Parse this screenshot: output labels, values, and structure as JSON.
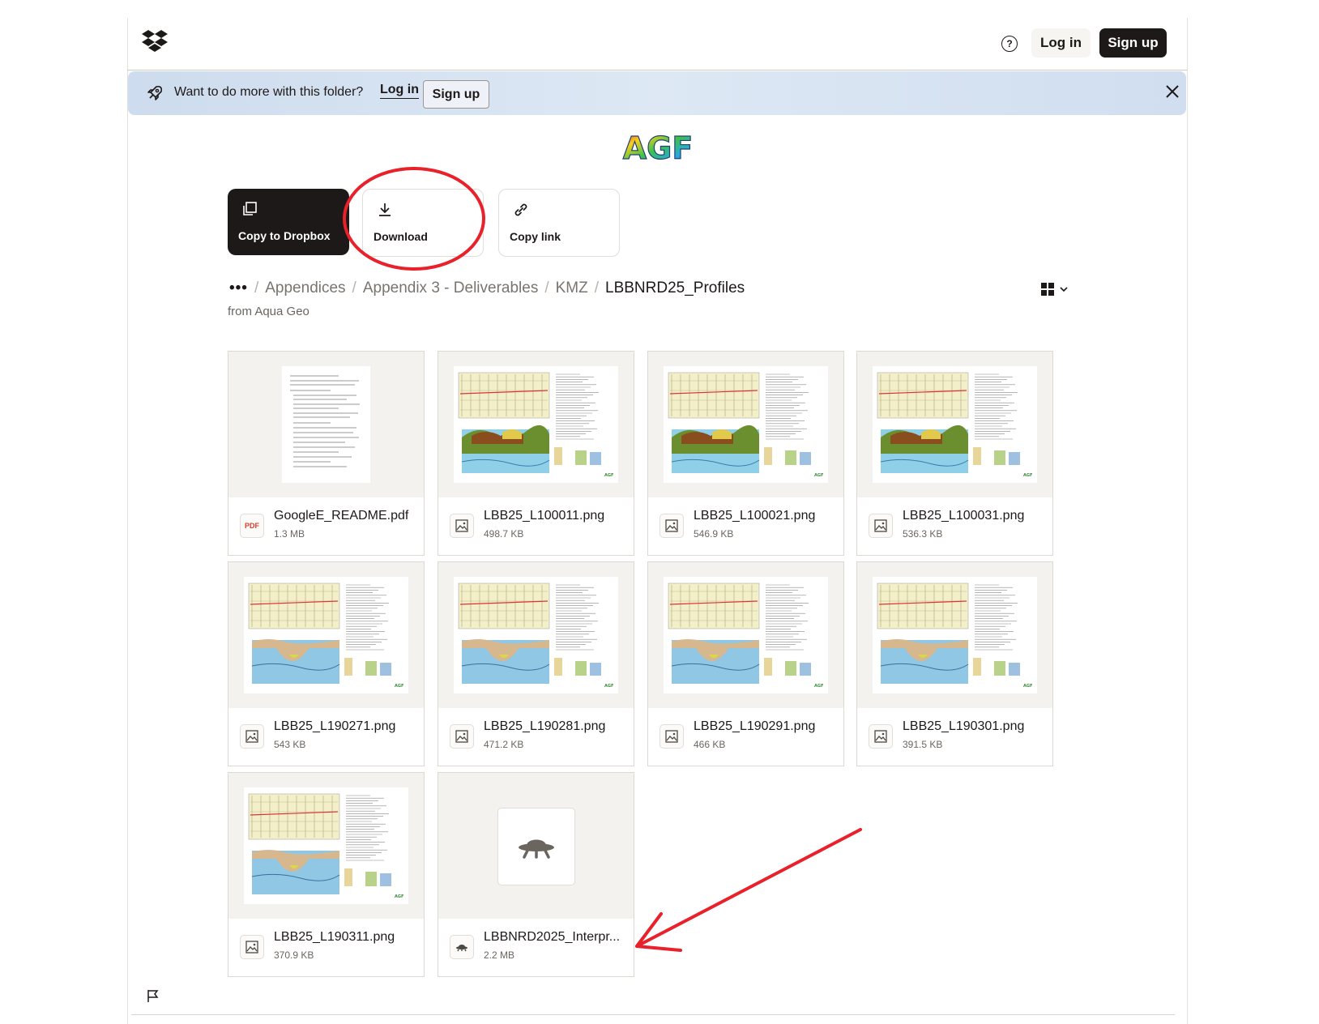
{
  "header": {
    "logo_icon": "dropbox-logo-icon",
    "help_icon": "question-mark-icon",
    "login_label": "Log in",
    "signup_label": "Sign up"
  },
  "banner": {
    "icon": "rocket-icon",
    "text": "Want to do more with this folder?",
    "login_label": "Log in",
    "signup_label": "Sign up",
    "close_icon": "close-icon"
  },
  "brand_logo_text": "AGF",
  "actions": {
    "copy_to_dropbox": "Copy to Dropbox",
    "download": "Download",
    "copy_link": "Copy link"
  },
  "breadcrumb": {
    "overflow": "•••",
    "items": [
      "Appendices",
      "Appendix 3 - Deliverables",
      "KMZ"
    ],
    "current": "LBBNRD25_Profiles",
    "owner": "from Aqua Geo"
  },
  "files": [
    {
      "name": "GoogleE_README.pdf",
      "size": "1.3 MB",
      "type": "pdf",
      "badge": "PDF"
    },
    {
      "name": "LBB25_L100011.png",
      "size": "498.7 KB",
      "type": "image"
    },
    {
      "name": "LBB25_L100021.png",
      "size": "546.9 KB",
      "type": "image"
    },
    {
      "name": "LBB25_L100031.png",
      "size": "536.3 KB",
      "type": "image"
    },
    {
      "name": "LBB25_L190271.png",
      "size": "543 KB",
      "type": "image"
    },
    {
      "name": "LBB25_L190281.png",
      "size": "471.2 KB",
      "type": "image"
    },
    {
      "name": "LBB25_L190291.png",
      "size": "466 KB",
      "type": "image"
    },
    {
      "name": "LBB25_L190301.png",
      "size": "391.5 KB",
      "type": "image"
    },
    {
      "name": "LBB25_L190311.png",
      "size": "370.9 KB",
      "type": "image"
    },
    {
      "name": "LBBNRD2025_Interpr...",
      "size": "2.2 MB",
      "type": "unknown"
    }
  ],
  "footer": {
    "flag_icon": "flag-icon"
  },
  "colors": {
    "dark": "#1e1919",
    "banner": "#d6e2f1",
    "annotation": "#e8212a"
  }
}
